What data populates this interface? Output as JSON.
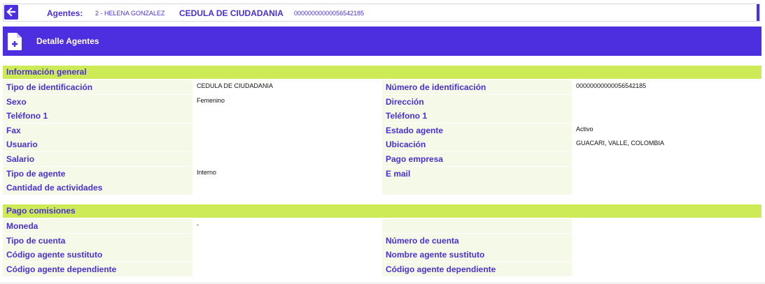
{
  "topbar": {
    "label": "Agentes:",
    "agent_name": "2 -  HELENA GONZALEZ",
    "doc_type": "CEDULA DE CIUDADANIA",
    "doc_number": "00000000000056542185"
  },
  "header": {
    "title": "Detalle Agentes"
  },
  "general": {
    "title": "Información general",
    "rows": [
      {
        "l1": "Tipo de identificación",
        "v1": "CEDULA DE CIUDADANIA",
        "l2": "Número de identificación",
        "v2": "00000000000056542185"
      },
      {
        "l1": "Sexo",
        "v1": "Femenino",
        "l2": "Dirección",
        "v2": ""
      },
      {
        "l1": "Teléfono 1",
        "v1": "",
        "l2": "Teléfono 1",
        "v2": ""
      },
      {
        "l1": "Fax",
        "v1": "",
        "l2": "Estado agente",
        "v2": "Activo"
      },
      {
        "l1": "Usuario",
        "v1": "",
        "l2": "Ubicación",
        "v2": "GUACARI, VALLE, COLOMBIA"
      },
      {
        "l1": "Salario",
        "v1": "",
        "l2": "Pago empresa",
        "v2": ""
      },
      {
        "l1": "Tipo de agente",
        "v1": "Interno",
        "l2": "E mail",
        "v2": ""
      },
      {
        "l1": "Cantidad de actividades",
        "v1": "",
        "l2": "",
        "v2": ""
      }
    ]
  },
  "commissions": {
    "title": "Pago comisiones",
    "rows": [
      {
        "l1": "Moneda",
        "v1": "-",
        "l2": "",
        "v2": ""
      },
      {
        "l1": "Tipo de cuenta",
        "v1": "",
        "l2": "Número de cuenta",
        "v2": ""
      },
      {
        "l1": "Código agente sustituto",
        "v1": "",
        "l2": "Nombre agente sustituto",
        "v2": ""
      },
      {
        "l1": "Código agente dependiente",
        "v1": "",
        "l2": "Código agente dependiente",
        "v2": ""
      }
    ]
  }
}
